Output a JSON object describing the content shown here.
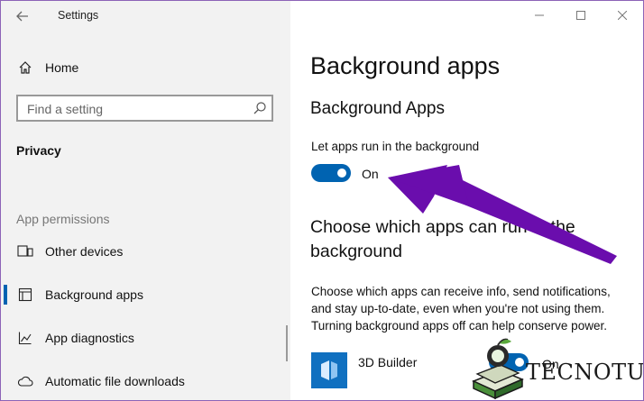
{
  "window": {
    "title": "Settings",
    "controls": [
      "minimize",
      "maximize",
      "close"
    ]
  },
  "sidebar": {
    "home_label": "Home",
    "search_placeholder": "Find a setting",
    "section_title": "Privacy",
    "group_title": "App permissions",
    "items": [
      {
        "label": "Other devices",
        "icon": "devices-icon",
        "selected": false
      },
      {
        "label": "Background apps",
        "icon": "background-apps-icon",
        "selected": true
      },
      {
        "label": "App diagnostics",
        "icon": "diagnostics-icon",
        "selected": false
      },
      {
        "label": "Automatic file downloads",
        "icon": "cloud-icon",
        "selected": false
      }
    ]
  },
  "main": {
    "page_title": "Background apps",
    "section_title": "Background Apps",
    "toggle_label": "Let apps run in the background",
    "toggle_state": "On",
    "choose_title": "Choose which apps can run in the background",
    "description": "Choose which apps can receive info, send notifications, and stay up-to-date, even when you're not using them. Turning background apps off can help conserve power.",
    "apps": [
      {
        "name": "3D Builder",
        "state": "On"
      }
    ]
  },
  "watermark": {
    "text": "TECNOTUTO"
  },
  "colors": {
    "accent": "#0063b1",
    "annotation_arrow": "#6a0dad",
    "sidebar_bg": "#f2f2f2"
  }
}
